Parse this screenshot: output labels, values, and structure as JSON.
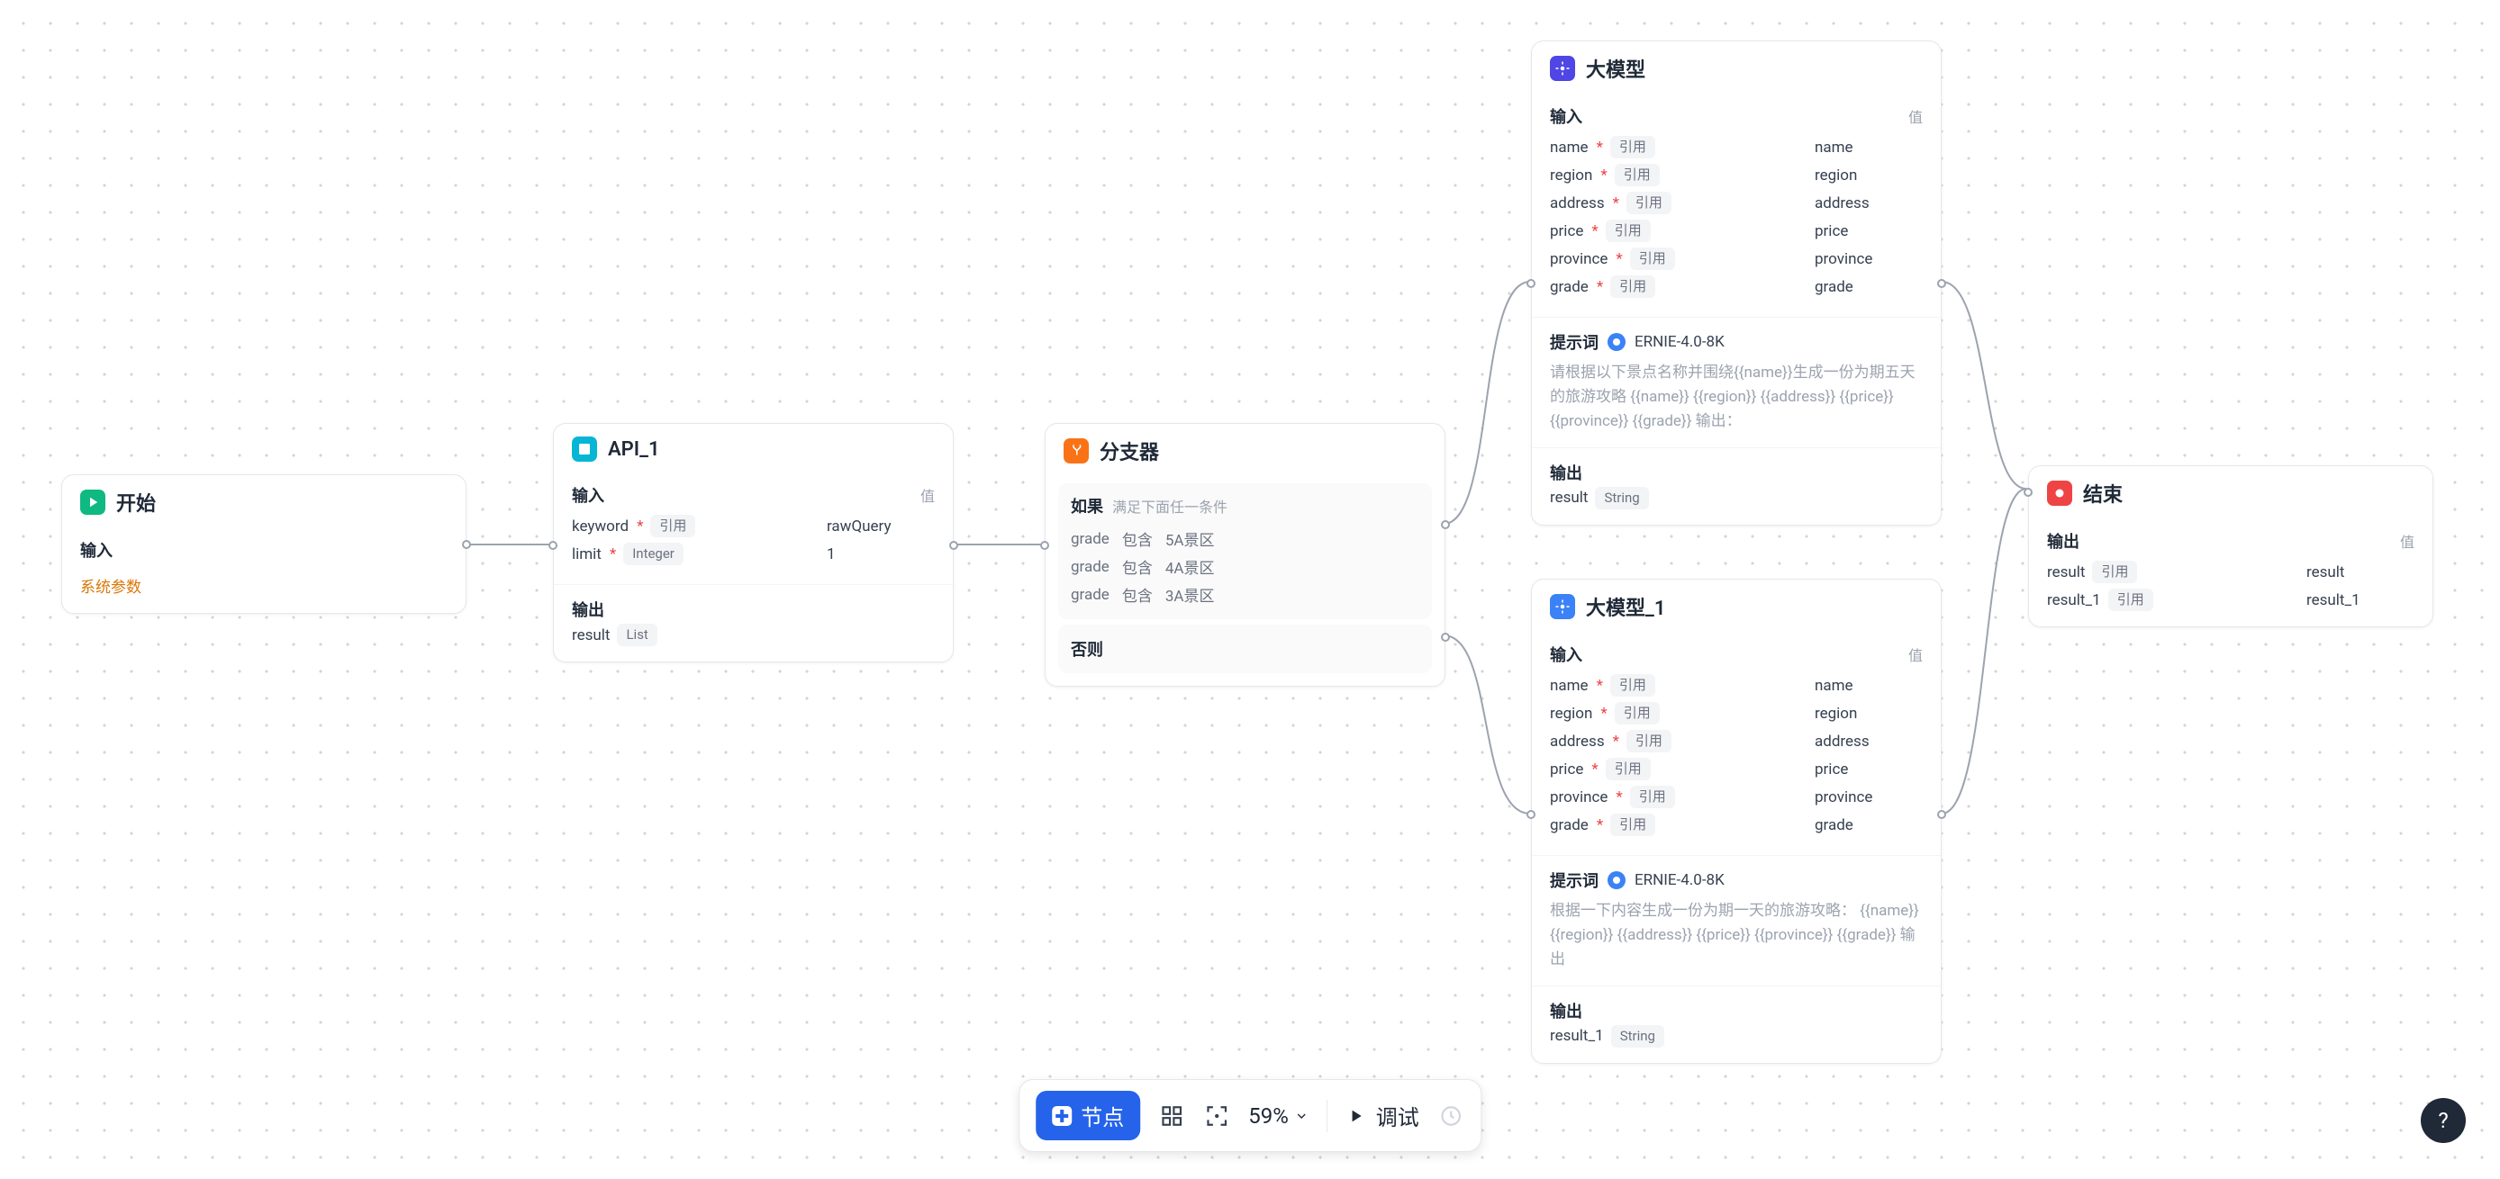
{
  "labels": {
    "input": "输入",
    "output": "输出",
    "value": "值",
    "ref": "引用",
    "sys_param": "系统参数",
    "if": "如果",
    "if_sub": "满足下面任一条件",
    "else": "否则",
    "contains": "包含",
    "prompt": "提示词",
    "node_btn": "节点",
    "debug": "调试",
    "zoom": "59%"
  },
  "start": {
    "title": "开始"
  },
  "api": {
    "title": "API_1",
    "inputs": [
      {
        "name": "keyword",
        "req": true,
        "tag": "引用",
        "val": "rawQuery"
      },
      {
        "name": "limit",
        "req": true,
        "tag": "Integer",
        "val": "1"
      }
    ],
    "outputs": [
      {
        "name": "result",
        "tag": "List"
      }
    ]
  },
  "branch": {
    "title": "分支器",
    "conds": [
      {
        "field": "grade",
        "op": "包含",
        "val": "5A景区"
      },
      {
        "field": "grade",
        "op": "包含",
        "val": "4A景区"
      },
      {
        "field": "grade",
        "op": "包含",
        "val": "3A景区"
      }
    ]
  },
  "llm1": {
    "title": "大模型",
    "inputs": [
      {
        "name": "name",
        "req": true,
        "tag": "引用",
        "val": "name"
      },
      {
        "name": "region",
        "req": true,
        "tag": "引用",
        "val": "region"
      },
      {
        "name": "address",
        "req": true,
        "tag": "引用",
        "val": "address"
      },
      {
        "name": "price",
        "req": true,
        "tag": "引用",
        "val": "price"
      },
      {
        "name": "province",
        "req": true,
        "tag": "引用",
        "val": "province"
      },
      {
        "name": "grade",
        "req": true,
        "tag": "引用",
        "val": "grade"
      }
    ],
    "model": "ERNIE-4.0-8K",
    "prompt": "请根据以下景点名称并围绕{{name}}生成一份为期五天的旅游攻略 {{name}} {{region}} {{address}} {{price}} {{province}} {{grade}} 输出：",
    "outputs": [
      {
        "name": "result",
        "tag": "String"
      }
    ]
  },
  "llm2": {
    "title": "大模型_1",
    "inputs": [
      {
        "name": "name",
        "req": true,
        "tag": "引用",
        "val": "name"
      },
      {
        "name": "region",
        "req": true,
        "tag": "引用",
        "val": "region"
      },
      {
        "name": "address",
        "req": true,
        "tag": "引用",
        "val": "address"
      },
      {
        "name": "price",
        "req": true,
        "tag": "引用",
        "val": "price"
      },
      {
        "name": "province",
        "req": true,
        "tag": "引用",
        "val": "province"
      },
      {
        "name": "grade",
        "req": true,
        "tag": "引用",
        "val": "grade"
      }
    ],
    "model": "ERNIE-4.0-8K",
    "prompt": "根据一下内容生成一份为期一天的旅游攻略： {{name}} {{region}} {{address}} {{price}} {{province}} {{grade}} 输出",
    "outputs": [
      {
        "name": "result_1",
        "tag": "String"
      }
    ]
  },
  "end": {
    "title": "结束",
    "outputs": [
      {
        "name": "result",
        "tag": "引用",
        "val": "result"
      },
      {
        "name": "result_1",
        "tag": "引用",
        "val": "result_1"
      }
    ]
  }
}
